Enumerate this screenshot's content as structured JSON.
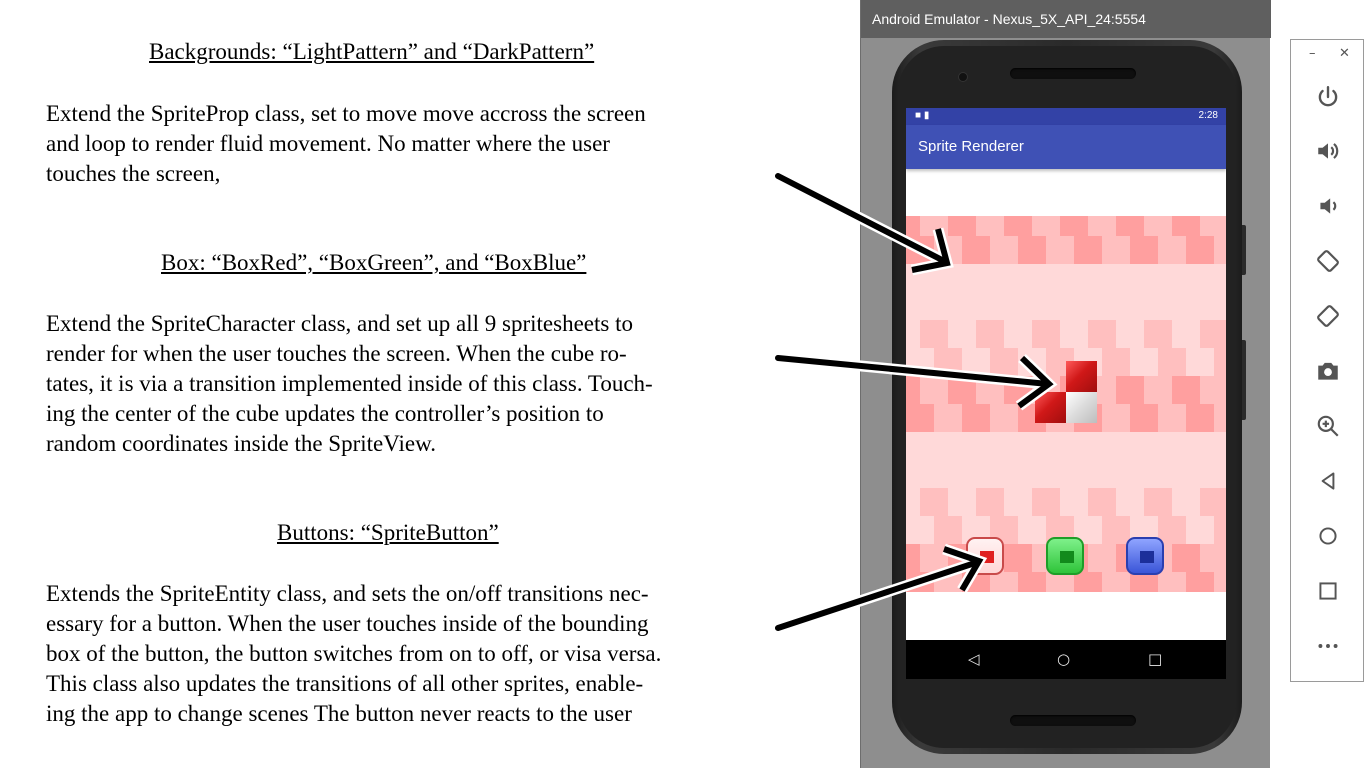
{
  "slide": {
    "sections": [
      {
        "heading": "Backgrounds: “LightPattern” and “DarkPattern”",
        "lines": [
          "Extend the SpriteProp class, set to move move accross the screen",
          "and loop to render fluid movement. No matter where the user",
          "touches the screen,"
        ]
      },
      {
        "heading": "Box: “BoxRed”, “BoxGreen”, and “BoxBlue”",
        "lines": [
          "Extend the SpriteCharacter class, and set up all 9 spritesheets to",
          "render for when the user touches the screen. When the cube ro-",
          "tates, it is via a transition implemented inside of this class. Touch-",
          "ing the center of  the cube updates the controller’s position to",
          "random coordinates inside the SpriteView."
        ]
      },
      {
        "heading": "Buttons: “SpriteButton”",
        "lines": [
          "Extends the SpriteEntity class, and sets the on/off transitions nec-",
          "essary for a button. When the user touches inside of the bounding",
          "box of the button, the button switches from on to off, or visa versa.",
          "This class also updates the transitions of all other sprites, enable-",
          "ing the app to change scenes The button never reacts to the user"
        ]
      }
    ]
  },
  "emulator": {
    "window_title": "Android Emulator - Nexus_5X_API_24:5554",
    "status_time": "2:28",
    "app_title": "Sprite Renderer",
    "pattern_colors": {
      "base": "#ffd9d9",
      "mid": "#ffbfbf",
      "dark": "#ff9f9f"
    },
    "cube_colors": {
      "red": "#e02020",
      "light": "#ededed"
    },
    "sprite_buttons": [
      {
        "name": "red",
        "color": "#e03030",
        "state": "on"
      },
      {
        "name": "green",
        "color": "#2fc43a",
        "state": "off"
      },
      {
        "name": "blue",
        "color": "#3a55d8",
        "state": "off"
      }
    ],
    "nav_icons": [
      "back-icon",
      "home-icon",
      "recents-icon"
    ],
    "toolbar_icons": [
      "power-icon",
      "volume-up-icon",
      "volume-down-icon",
      "rotate-left-icon",
      "rotate-right-icon",
      "screenshot-icon",
      "zoom-icon",
      "back-icon",
      "home-icon",
      "overview-icon",
      "more-icon"
    ]
  }
}
